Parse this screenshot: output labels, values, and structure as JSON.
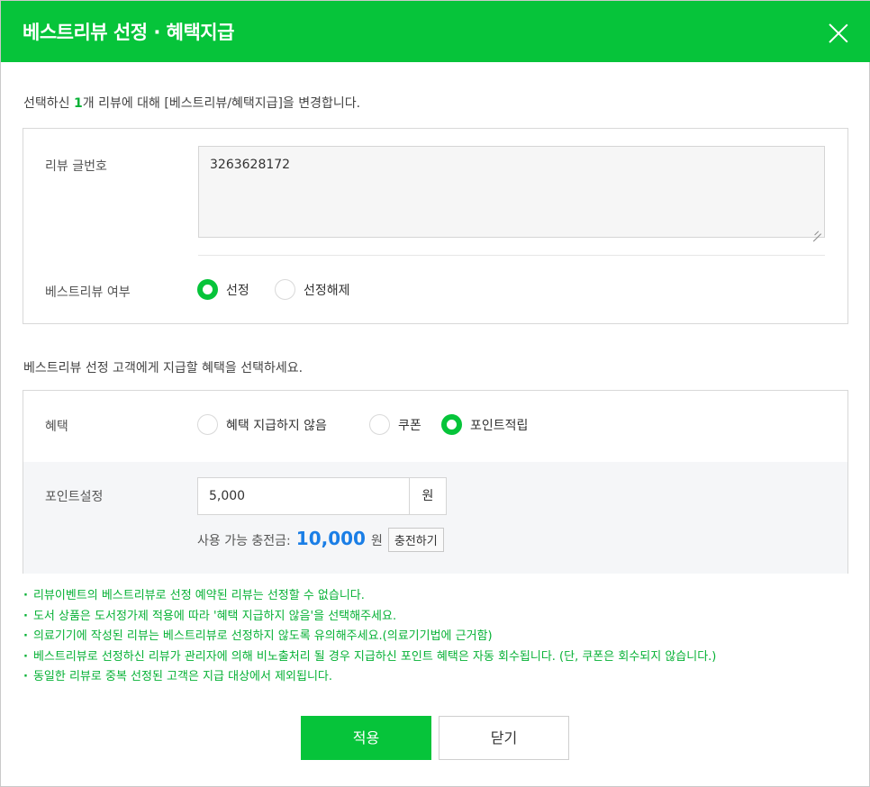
{
  "dialog": {
    "title": "베스트리뷰 선정 · 혜택지급",
    "close_icon": "close-icon"
  },
  "intro": {
    "prefix": "선택하신 ",
    "count": "1",
    "suffix": "개 리뷰에 대해 [베스트리뷰/혜택지급]을 변경합니다."
  },
  "review": {
    "number_label": "리뷰 글번호",
    "number_value": "3263628172",
    "best_label": "베스트리뷰 여부",
    "best_options": [
      {
        "label": "선정",
        "selected": true
      },
      {
        "label": "선정해제",
        "selected": false
      }
    ]
  },
  "benefit_guide": "베스트리뷰 선정 고객에게 지급할 혜택을 선택하세요.",
  "benefit": {
    "label": "혜택",
    "options": [
      {
        "label": "혜택 지급하지 않음",
        "selected": false
      },
      {
        "label": "쿠폰",
        "selected": false
      },
      {
        "label": "포인트적립",
        "selected": true
      }
    ],
    "point_label": "포인트설정",
    "point_value": "5,000",
    "point_unit": "원",
    "available_label": "사용 가능 충전금:",
    "available_amount": "10,000",
    "available_unit": "원",
    "charge_button": "충전하기"
  },
  "notes": [
    "리뷰이벤트의 베스트리뷰로 선정 예약된 리뷰는 선정할 수 없습니다.",
    "도서 상품은 도서정가제 적용에 따라 '혜택 지급하지 않음'을 선택해주세요.",
    "의료기기에 작성된 리뷰는 베스트리뷰로 선정하지 않도록 유의해주세요.(의료기기법에 근거함)",
    "베스트리뷰로 선정하신 리뷰가 관리자에 의해 비노출처리 될 경우 지급하신 포인트 혜택은 자동 회수됩니다. (단, 쿠폰은 회수되지 않습니다.)",
    "동일한 리뷰로 중복 선정된 고객은 지급 대상에서 제외됩니다."
  ],
  "buttons": {
    "apply": "적용",
    "close": "닫기"
  },
  "colors": {
    "brand": "#06c43a",
    "note_text": "#06b135",
    "amount": "#1a7ee6"
  }
}
